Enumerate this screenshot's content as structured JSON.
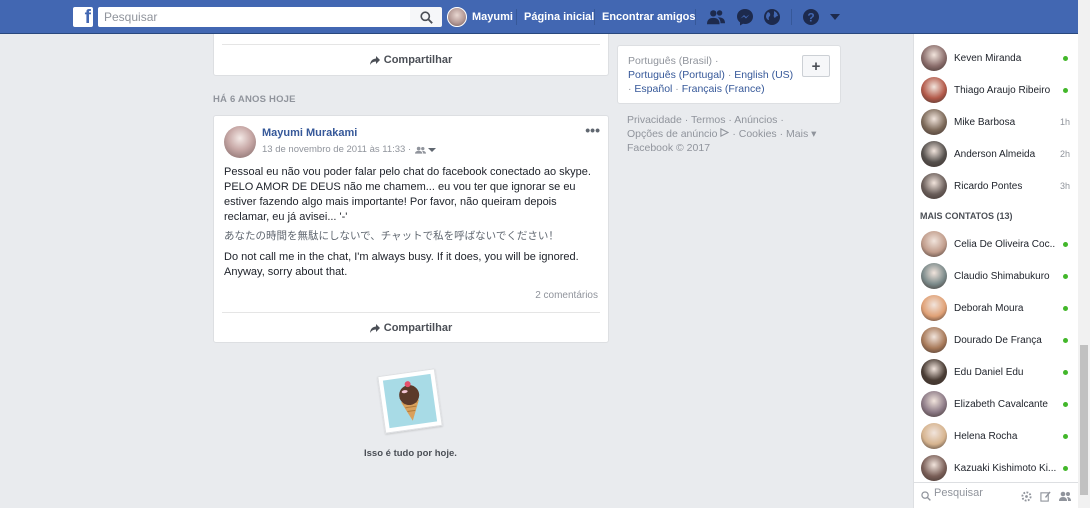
{
  "topbar": {
    "logo": "f",
    "search_placeholder": "Pesquisar",
    "user_name": "Mayumi",
    "home_label": "Página inicial",
    "find_friends_label": "Encontrar amigos",
    "icons": [
      "friend-requests-icon",
      "messenger-icon",
      "notifications-globe-icon",
      "help-icon",
      "chevron-down-icon"
    ]
  },
  "feed": {
    "share_label_top": "Compartilhar",
    "section_title": "HÁ 6 ANOS HOJE",
    "post": {
      "author": "Mayumi Murakami",
      "timestamp": "13 de novembro de 2011 às 11:33 ·",
      "dots": "•••",
      "text_pt": "Pessoal eu não vou poder falar pelo chat do facebook conectado ao skype. PELO AMOR DE DEUS não me chamem... eu vou ter que ignorar se eu estiver fazendo algo mais importante! Por favor, não queiram depois reclamar, eu já avisei... '-'",
      "text_jp": "あなたの時間を無駄にしないで、チャットで私を呼ばないでください！",
      "text_en": "Do not call me in the chat, I'm always busy. If it does, you will be ignored. Anyway, sorry about that.",
      "comments": "2 comentários",
      "share_label": "Compartilhar"
    },
    "end_message": "Isso é tudo por hoje."
  },
  "languages": {
    "current": "Português (Brasil) ·",
    "options": [
      "Português (Portugal)",
      "English (US)",
      "Español",
      "Français (France)"
    ],
    "sep": "·",
    "add_label": "+"
  },
  "footer": {
    "privacy": "Privacidade",
    "terms": "Termos",
    "ads": "Anúncios",
    "ad_choices": "Opções de anúncio",
    "cookies": "Cookies",
    "more": "Mais",
    "copyright": "Facebook © 2017",
    "sep": "·"
  },
  "chat": {
    "contacts": [
      {
        "name": "Keven Miranda",
        "status": "online",
        "color": "#8a6d6b"
      },
      {
        "name": "Thiago Araujo Ribeiro",
        "status": "online",
        "color": "#b35a4a"
      },
      {
        "name": "Mike Barbosa",
        "status": "1h",
        "color": "#7d6a5a"
      },
      {
        "name": "Anderson Almeida",
        "status": "2h",
        "color": "#55504d"
      },
      {
        "name": "Ricardo Pontes",
        "status": "3h",
        "color": "#6a5e5a"
      }
    ],
    "more_contacts_title": "MAIS CONTATOS (13)",
    "more_contacts": [
      {
        "name": "Celia De Oliveira Coc...",
        "status": "online",
        "color": "#c19d8c"
      },
      {
        "name": "Claudio Shimabukuro",
        "status": "online",
        "color": "#7b8a8a"
      },
      {
        "name": "Deborah Moura",
        "status": "online",
        "color": "#e0a176"
      },
      {
        "name": "Dourado De França",
        "status": "online",
        "color": "#a87a5a"
      },
      {
        "name": "Edu Daniel Edu",
        "status": "online",
        "color": "#4a3d35"
      },
      {
        "name": "Elizabeth Cavalcante",
        "status": "online",
        "color": "#8c7a86"
      },
      {
        "name": "Helena Rocha",
        "status": "online",
        "color": "#d6b48f"
      },
      {
        "name": "Kazuaki Kishimoto Ki...",
        "status": "online",
        "color": "#7a5f58"
      }
    ],
    "search_placeholder": "Pesquisar",
    "online_color": "#42b72a"
  }
}
